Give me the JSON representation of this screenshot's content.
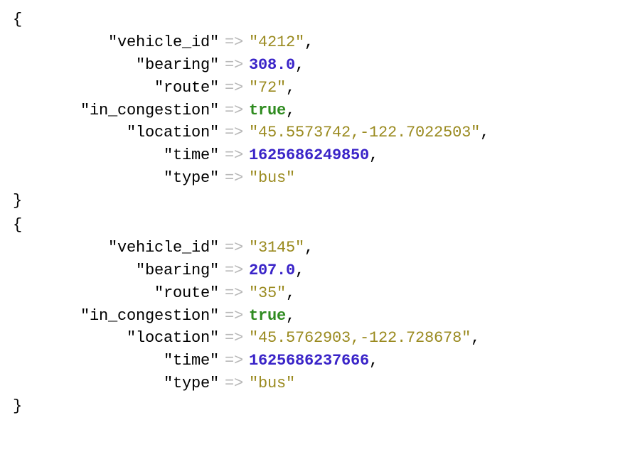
{
  "arrow": "=>",
  "records": [
    {
      "fields": [
        {
          "key": "vehicle_id",
          "value": "4212",
          "type": "string"
        },
        {
          "key": "bearing",
          "value": "308.0",
          "type": "number"
        },
        {
          "key": "route",
          "value": "72",
          "type": "string"
        },
        {
          "key": "in_congestion",
          "value": "true",
          "type": "bool"
        },
        {
          "key": "location",
          "value": "45.5573742,-122.7022503",
          "type": "string"
        },
        {
          "key": "time",
          "value": "1625686249850",
          "type": "number"
        },
        {
          "key": "type",
          "value": "bus",
          "type": "string"
        }
      ]
    },
    {
      "fields": [
        {
          "key": "vehicle_id",
          "value": "3145",
          "type": "string"
        },
        {
          "key": "bearing",
          "value": "207.0",
          "type": "number"
        },
        {
          "key": "route",
          "value": "35",
          "type": "string"
        },
        {
          "key": "in_congestion",
          "value": "true",
          "type": "bool"
        },
        {
          "key": "location",
          "value": "45.5762903,-122.728678",
          "type": "string"
        },
        {
          "key": "time",
          "value": "1625686237666",
          "type": "number"
        },
        {
          "key": "type",
          "value": "bus",
          "type": "string"
        }
      ]
    }
  ]
}
